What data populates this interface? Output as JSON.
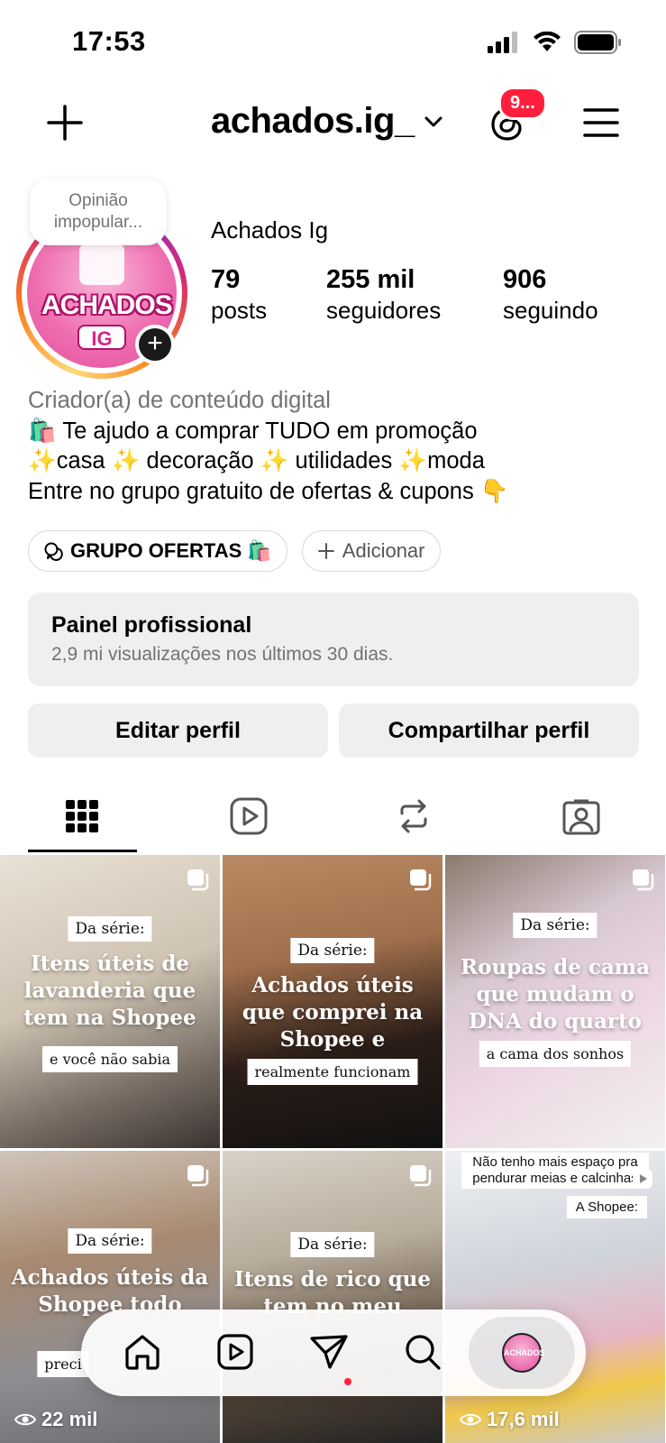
{
  "status_bar": {
    "time": "17:53"
  },
  "header": {
    "username": "achados.ig_",
    "notification_badge": "9..."
  },
  "profile": {
    "note": "Opinião impopular...",
    "name": "Achados Ig",
    "avatar_text_top": "ACHADOS",
    "avatar_text_bottom": "IG",
    "stats": [
      {
        "value": "79",
        "label": "posts"
      },
      {
        "value": "255 mil",
        "label": "seguidores"
      },
      {
        "value": "906",
        "label": "seguindo"
      }
    ],
    "category": "Criador(a) de conteúdo digital",
    "bio_lines": [
      "🛍️ Te ajudo a comprar TUDO em promoção",
      "✨casa ✨ decoração ✨ utilidades ✨moda",
      "Entre no grupo gratuito de ofertas & cupons  👇"
    ]
  },
  "chips": {
    "group": "GRUPO OFERTAS 🛍️",
    "add": "Adicionar"
  },
  "panel": {
    "title": "Painel profissional",
    "subtitle": "2,9 mi visualizações nos últimos 30 dias."
  },
  "actions": {
    "edit": "Editar perfil",
    "share": "Compartilhar perfil"
  },
  "posts": [
    {
      "serie": "Da série:",
      "headline": "Itens úteis de lavanderia que tem na Shopee",
      "foot": "e você não sabia"
    },
    {
      "serie": "Da série:",
      "headline": "Achados úteis que comprei na Shopee e",
      "foot": "realmente funcionam"
    },
    {
      "serie": "Da série:",
      "headline": "Roupas de cama que mudam o DNA do quarto",
      "foot": "a cama dos sonhos"
    },
    {
      "serie": "Da série:",
      "headline": "Achados úteis da Shopee todo",
      "foot": "preci",
      "views": "22 mil"
    },
    {
      "serie": "Da série:",
      "headline": "Itens de rico que tem no meu"
    },
    {
      "topnote": "Não tenho mais espaço pra pendurar meias e calcinhas",
      "shopee": "A Shopee:",
      "views": "17,6 mil"
    }
  ],
  "colors": {
    "accent_red": "#ff1f3d",
    "button_bg": "#efeff2",
    "secondary_text": "#737373",
    "brand_pink": "#e24d9b"
  },
  "icons": {
    "header": [
      "plus-icon",
      "chevron-down-icon",
      "threads-icon",
      "hamburger-menu-icon"
    ],
    "tabs": [
      "grid-icon",
      "reels-icon",
      "reposts-icon",
      "tagged-icon"
    ],
    "nav": [
      "home-icon",
      "reels-icon",
      "direct-send-icon",
      "search-icon",
      "profile-avatar"
    ]
  }
}
